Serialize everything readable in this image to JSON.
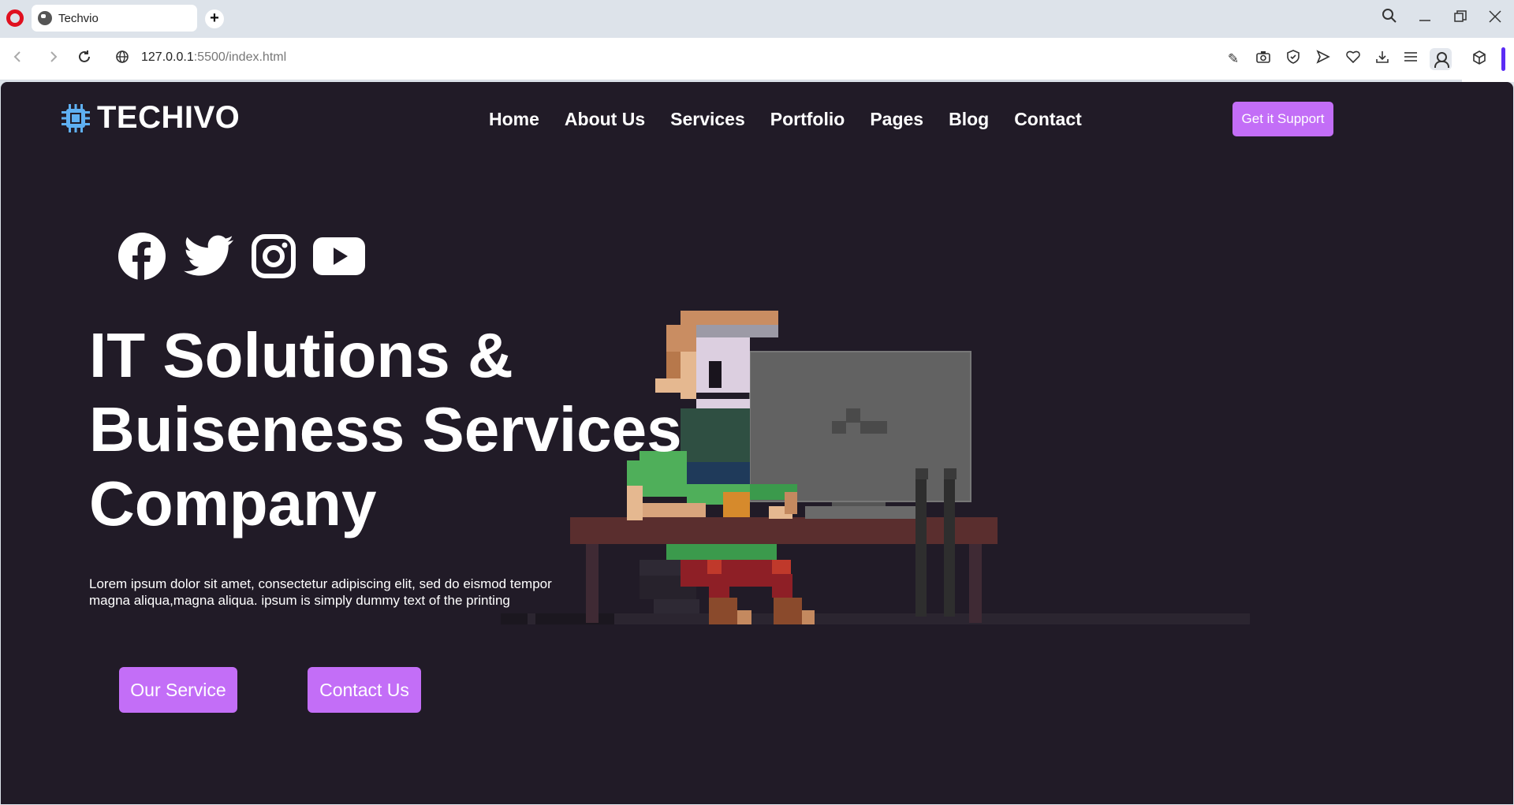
{
  "browser": {
    "tab_title": "Techvio",
    "url_host": "127.0.0.1",
    "url_path": ":5500/index.html"
  },
  "site": {
    "brand": "TECHIVO",
    "nav": [
      "Home",
      "About Us",
      "Services",
      "Portfolio",
      "Pages",
      "Blog",
      "Contact"
    ],
    "support_button": "Get it Support",
    "socials": [
      "facebook-icon",
      "twitter-icon",
      "instagram-icon",
      "youtube-icon"
    ],
    "hero": {
      "title_lines": [
        "IT Solutions &",
        "Buiseness Services",
        "Company"
      ],
      "description_lines": [
        "Lorem ipsum dolor sit amet, consectetur adipiscing elit, sed do eismod tempor",
        "magna aliqua,magna aliqua. ipsum is simply dummy text of the printing"
      ],
      "primary_button": "Our Service",
      "secondary_button": "Contact Us"
    },
    "colors": {
      "background": "#211b27",
      "accent": "#c36ef7",
      "logo_icon": "#5fb0f2"
    }
  }
}
